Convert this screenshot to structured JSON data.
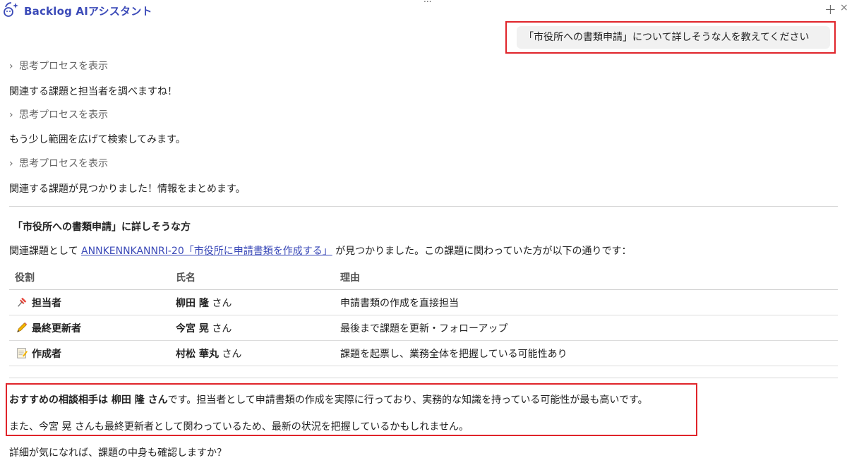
{
  "header": {
    "title": "Backlog AIアシスタント",
    "dots": "...",
    "plus": "+",
    "edge_close": "×"
  },
  "user_message": "「市役所への書類申請」について詳しそうな人を教えてください",
  "thinking_label": "思考プロセスを表示",
  "assistant_steps": [
    "関連する課題と担当者を調べますね！",
    "もう少し範囲を広げて検索してみます。",
    "関連する課題が見つかりました！情報をまとめます。"
  ],
  "section_title": "「市役所への書類申請」に詳しそうな方",
  "related": {
    "prefix": "関連課題として",
    "link": "ANNKENNKANNRI-20「市役所に申請書類を作成する」",
    "suffix": "が見つかりました。この課題に関わっていた方が以下の通りです："
  },
  "table": {
    "headers": [
      "役割",
      "氏名",
      "理由"
    ],
    "rows": [
      {
        "icon": "pushpin-icon",
        "role": "担当者",
        "name": "柳田 隆",
        "honorific": "さん",
        "reason": "申請書類の作成を直接担当"
      },
      {
        "icon": "pencil-icon",
        "role": "最終更新者",
        "name": "今宮 晃",
        "honorific": "さん",
        "reason": "最後まで課題を更新・フォローアップ"
      },
      {
        "icon": "memo-icon",
        "role": "作成者",
        "name": "村松 華丸",
        "honorific": "さん",
        "reason": "課題を起票し、業務全体を把握している可能性あり"
      }
    ]
  },
  "recommendation": {
    "bold": "おすすめの相談相手は 柳田 隆 さん",
    "rest": "です。担当者として申請書類の作成を実際に行っており、実務的な知識を持っている可能性が最も高いです。",
    "line2": "また、今宮 晃 さんも最終更新者として関わっているため、最新の状況を把握しているかもしれません。"
  },
  "closing_question": "詳細が気になれば、課題の中身も確認しますか？",
  "colors": {
    "brand": "#3b4ab8",
    "highlight_border": "#e0242a",
    "bubble_bg": "#f1f1f1"
  }
}
